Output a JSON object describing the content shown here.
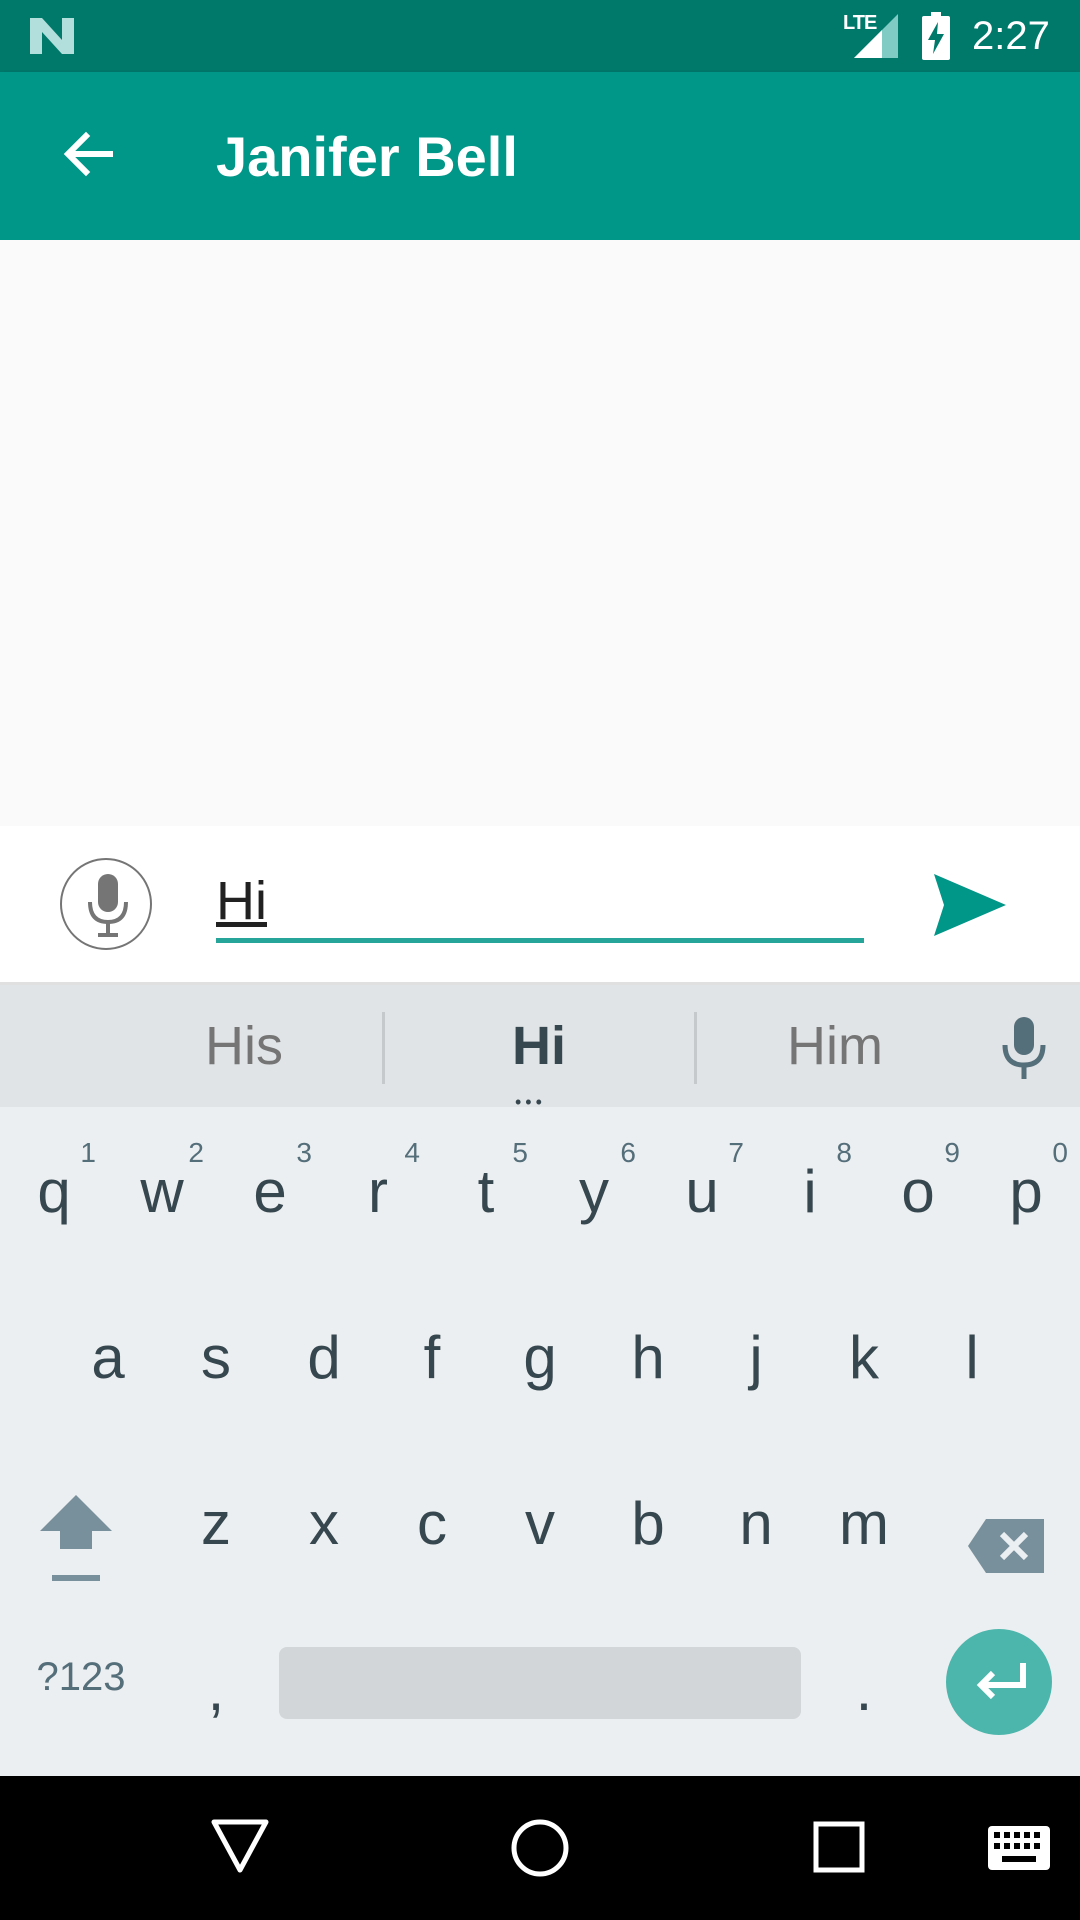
{
  "status_bar": {
    "network": "LTE",
    "time": "2:27"
  },
  "app_bar": {
    "title": "Janifer Bell"
  },
  "composer": {
    "input_value": "Hi"
  },
  "suggestions": {
    "left": "His",
    "center": "Hi",
    "right": "Him"
  },
  "keyboard": {
    "row1": [
      {
        "ch": "q",
        "hint": "1"
      },
      {
        "ch": "w",
        "hint": "2"
      },
      {
        "ch": "e",
        "hint": "3"
      },
      {
        "ch": "r",
        "hint": "4"
      },
      {
        "ch": "t",
        "hint": "5"
      },
      {
        "ch": "y",
        "hint": "6"
      },
      {
        "ch": "u",
        "hint": "7"
      },
      {
        "ch": "i",
        "hint": "8"
      },
      {
        "ch": "o",
        "hint": "9"
      },
      {
        "ch": "p",
        "hint": "0"
      }
    ],
    "row2": [
      "a",
      "s",
      "d",
      "f",
      "g",
      "h",
      "j",
      "k",
      "l"
    ],
    "row3": [
      "z",
      "x",
      "c",
      "v",
      "b",
      "n",
      "m"
    ],
    "symbols_label": "?123",
    "comma": ",",
    "period": "."
  },
  "colors": {
    "primary": "#009688",
    "primary_dark": "#00796b",
    "accent": "#26a69a"
  }
}
